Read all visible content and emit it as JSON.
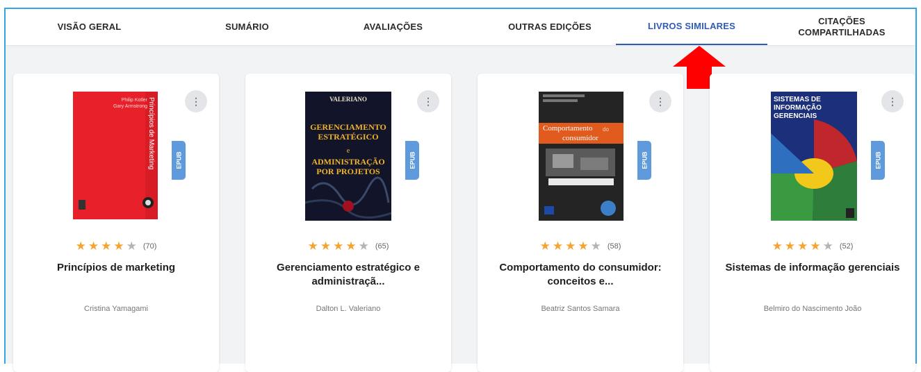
{
  "tabs": [
    {
      "label": "VISÃO GERAL"
    },
    {
      "label": "SUMÁRIO"
    },
    {
      "label": "AVALIAÇÕES"
    },
    {
      "label": "OUTRAS EDIÇÕES"
    },
    {
      "label": "LIVROS SIMILARES",
      "active": true
    },
    {
      "label": "CITAÇÕES\nCOMPARTILHADAS"
    }
  ],
  "colors": {
    "accent": "#2f5bb8",
    "star": "#f3a532",
    "epub_badge": "#5f9bdc",
    "annotation_arrow": "#ff0000"
  },
  "books": [
    {
      "title": "Princípios de marketing",
      "author": "Cristina Yamagami",
      "rating_stars": 4,
      "rating_count": "(70)",
      "badge": "EPUB",
      "menu_icon": "⋮",
      "cover": {
        "authors": "Philip Kotler\nGary Armstrong",
        "spine_title": "Princípios de Marketing"
      }
    },
    {
      "title": "Gerenciamento estratégico e administraçã...",
      "author": "Dalton L. Valeriano",
      "rating_stars": 4,
      "rating_count": "(65)",
      "badge": "EPUB",
      "menu_icon": "⋮",
      "cover": {
        "author": "VALERIANO",
        "line1": "GERENCIAMENTO",
        "line2": "ESTRATÉGICO",
        "line3": "e",
        "line4": "ADMINISTRAÇÃO",
        "line5": "POR PROJETOS"
      }
    },
    {
      "title": "Comportamento do consumidor: conceitos e...",
      "author": "Beatriz Santos Samara",
      "rating_stars": 4,
      "rating_count": "(58)",
      "badge": "EPUB",
      "menu_icon": "⋮",
      "cover": {
        "title_a": "Comportamento",
        "title_b": "do",
        "title_c": "consumidor"
      }
    },
    {
      "title": "Sistemas de informação gerenciais",
      "author": "Belmiro do Nascimento João",
      "rating_stars": 4,
      "rating_count": "(52)",
      "badge": "EPUB",
      "menu_icon": "⋮",
      "cover": {
        "line1": "SISTEMAS DE",
        "line2": "INFORMAÇÃO",
        "line3": "GERENCIAIS"
      }
    }
  ]
}
